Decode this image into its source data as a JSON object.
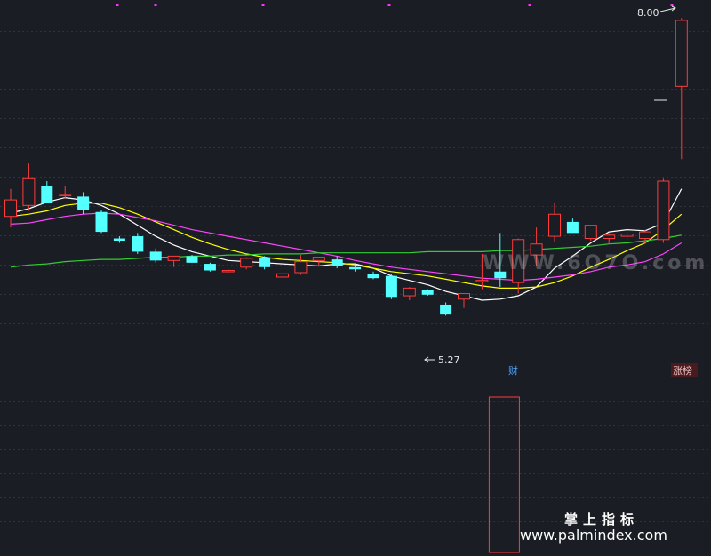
{
  "chart_data": {
    "type": "candlestick",
    "price_range": [
      4.9,
      8.1
    ],
    "candles": [
      {
        "o": 6.2,
        "h": 6.45,
        "l": 6.1,
        "c": 6.35
      },
      {
        "o": 6.3,
        "h": 6.68,
        "l": 6.25,
        "c": 6.55
      },
      {
        "o": 6.48,
        "h": 6.52,
        "l": 6.32,
        "c": 6.32
      },
      {
        "o": 6.4,
        "h": 6.48,
        "l": 6.36,
        "c": 6.4
      },
      {
        "o": 6.38,
        "h": 6.42,
        "l": 6.22,
        "c": 6.26
      },
      {
        "o": 6.24,
        "h": 6.26,
        "l": 6.05,
        "c": 6.06
      },
      {
        "o": 6.0,
        "h": 6.02,
        "l": 5.96,
        "c": 5.98
      },
      {
        "o": 6.02,
        "h": 6.05,
        "l": 5.86,
        "c": 5.88
      },
      {
        "o": 5.88,
        "h": 5.91,
        "l": 5.78,
        "c": 5.8
      },
      {
        "o": 5.8,
        "h": 5.84,
        "l": 5.74,
        "c": 5.84
      },
      {
        "o": 5.84,
        "h": 5.85,
        "l": 5.78,
        "c": 5.78
      },
      {
        "o": 5.77,
        "h": 5.78,
        "l": 5.7,
        "c": 5.71
      },
      {
        "o": 5.7,
        "h": 5.72,
        "l": 5.69,
        "c": 5.71
      },
      {
        "o": 5.74,
        "h": 5.83,
        "l": 5.72,
        "c": 5.82
      },
      {
        "o": 5.82,
        "h": 5.84,
        "l": 5.72,
        "c": 5.74
      },
      {
        "o": 5.65,
        "h": 5.68,
        "l": 5.65,
        "c": 5.68
      },
      {
        "o": 5.69,
        "h": 5.85,
        "l": 5.67,
        "c": 5.79
      },
      {
        "o": 5.8,
        "h": 5.83,
        "l": 5.75,
        "c": 5.83
      },
      {
        "o": 5.81,
        "h": 5.84,
        "l": 5.73,
        "c": 5.75
      },
      {
        "o": 5.74,
        "h": 5.76,
        "l": 5.7,
        "c": 5.72
      },
      {
        "o": 5.68,
        "h": 5.7,
        "l": 5.63,
        "c": 5.64
      },
      {
        "o": 5.66,
        "h": 5.68,
        "l": 5.45,
        "c": 5.47
      },
      {
        "o": 5.48,
        "h": 5.56,
        "l": 5.44,
        "c": 5.55
      },
      {
        "o": 5.53,
        "h": 5.54,
        "l": 5.48,
        "c": 5.49
      },
      {
        "o": 5.4,
        "h": 5.42,
        "l": 5.3,
        "c": 5.31
      },
      {
        "o": 5.45,
        "h": 5.5,
        "l": 5.37,
        "c": 5.5
      },
      {
        "o": 5.62,
        "h": 5.86,
        "l": 5.54,
        "c": 5.62
      },
      {
        "o": 5.7,
        "h": 6.05,
        "l": 5.56,
        "c": 5.64
      },
      {
        "o": 5.6,
        "h": 6.0,
        "l": 5.5,
        "c": 5.99
      },
      {
        "o": 5.85,
        "h": 6.1,
        "l": 5.75,
        "c": 5.95
      },
      {
        "o": 6.02,
        "h": 6.32,
        "l": 5.97,
        "c": 6.22
      },
      {
        "o": 6.15,
        "h": 6.18,
        "l": 6.05,
        "c": 6.05
      },
      {
        "o": 6.0,
        "h": 6.12,
        "l": 5.98,
        "c": 6.12
      },
      {
        "o": 6.0,
        "h": 6.05,
        "l": 5.95,
        "c": 6.03
      },
      {
        "o": 6.02,
        "h": 6.06,
        "l": 5.99,
        "c": 6.04
      },
      {
        "o": 6.0,
        "h": 6.08,
        "l": 5.95,
        "c": 6.06
      },
      {
        "o": 5.99,
        "h": 6.55,
        "l": 5.96,
        "c": 6.52
      },
      {
        "o": 7.38,
        "h": 8.0,
        "l": 6.72,
        "c": 7.98
      }
    ],
    "moving_averages": [
      {
        "color": "#ffffff",
        "values": [
          6.23,
          6.27,
          6.33,
          6.37,
          6.35,
          6.3,
          6.22,
          6.12,
          6.02,
          5.94,
          5.88,
          5.84,
          5.8,
          5.79,
          5.78,
          5.77,
          5.76,
          5.75,
          5.77,
          5.77,
          5.73,
          5.66,
          5.62,
          5.58,
          5.52,
          5.48,
          5.44,
          5.45,
          5.48,
          5.56,
          5.73,
          5.84,
          5.96,
          6.06,
          6.08,
          6.07,
          6.14,
          6.45
        ]
      },
      {
        "color": "#ffff00",
        "values": [
          6.2,
          6.22,
          6.25,
          6.3,
          6.32,
          6.32,
          6.28,
          6.22,
          6.15,
          6.08,
          6.01,
          5.95,
          5.9,
          5.86,
          5.83,
          5.81,
          5.8,
          5.79,
          5.78,
          5.76,
          5.73,
          5.7,
          5.68,
          5.66,
          5.63,
          5.6,
          5.57,
          5.55,
          5.55,
          5.56,
          5.6,
          5.66,
          5.74,
          5.81,
          5.89,
          5.96,
          6.08,
          6.22
        ]
      },
      {
        "color": "#ff44ff",
        "values": [
          6.13,
          6.14,
          6.17,
          6.2,
          6.22,
          6.23,
          6.22,
          6.19,
          6.16,
          6.12,
          6.08,
          6.05,
          6.02,
          5.99,
          5.96,
          5.93,
          5.9,
          5.87,
          5.84,
          5.8,
          5.77,
          5.74,
          5.72,
          5.7,
          5.68,
          5.66,
          5.64,
          5.63,
          5.62,
          5.63,
          5.65,
          5.67,
          5.7,
          5.74,
          5.76,
          5.79,
          5.86,
          5.96
        ]
      },
      {
        "color": "#33cc33",
        "values": [
          5.74,
          5.76,
          5.77,
          5.79,
          5.8,
          5.81,
          5.81,
          5.82,
          5.83,
          5.83,
          5.84,
          5.84,
          5.85,
          5.85,
          5.86,
          5.86,
          5.86,
          5.87,
          5.87,
          5.87,
          5.87,
          5.87,
          5.87,
          5.88,
          5.88,
          5.88,
          5.88,
          5.89,
          5.89,
          5.9,
          5.91,
          5.92,
          5.93,
          5.95,
          5.96,
          5.98,
          6.0,
          6.03
        ]
      }
    ],
    "annotations": {
      "high_label": "8.00",
      "low_label": "5.27",
      "tag_cai": "财",
      "tag_zhangting": "涨榜"
    },
    "colors": {
      "up": "#ff3b3b",
      "down": "#54ffff",
      "background": "#1a1d24"
    },
    "sub_panel": {
      "bars": [
        {
          "index": 26,
          "value": 1.0
        }
      ]
    }
  },
  "watermark": "WWW.6O7O.com",
  "brand": {
    "cn": "掌上指标",
    "url": "www.palmindex.com"
  }
}
